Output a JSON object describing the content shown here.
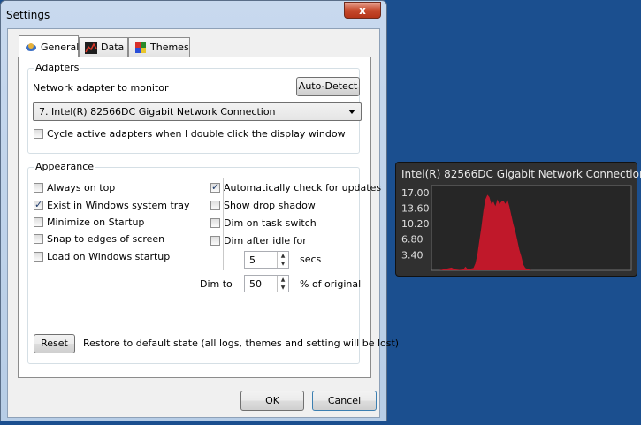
{
  "window": {
    "title": "Settings",
    "close_glyph": "x"
  },
  "tabs": [
    {
      "label": "General",
      "icon": "gear-icon",
      "active": true
    },
    {
      "label": "Data",
      "icon": "chart-icon",
      "active": false
    },
    {
      "label": "Themes",
      "icon": "palette-icon",
      "active": false
    }
  ],
  "adapters": {
    "group_label": "Adapters",
    "monitor_label": "Network adapter to monitor",
    "auto_detect": "Auto-Detect",
    "selected_adapter": "7. Intel(R) 82566DC Gigabit Network Connection",
    "cycle_label": "Cycle active adapters when I double click the display window",
    "cycle_checked": false
  },
  "appearance": {
    "group_label": "Appearance",
    "left_options": [
      {
        "label": "Always on top",
        "checked": false
      },
      {
        "label": "Exist in Windows system tray",
        "checked": true
      },
      {
        "label": "Minimize on Startup",
        "checked": false
      },
      {
        "label": "Snap to edges of screen",
        "checked": false
      },
      {
        "label": "Load on Windows startup",
        "checked": false
      }
    ],
    "right_options": [
      {
        "label": "Automatically check for updates",
        "checked": true
      },
      {
        "label": "Show drop shadow",
        "checked": false
      },
      {
        "label": "Dim on task switch",
        "checked": false
      },
      {
        "label": "Dim after idle for",
        "checked": false
      }
    ],
    "idle_value": "5",
    "idle_unit": "secs",
    "dim_to_label": "Dim to",
    "dim_value": "50",
    "dim_unit": "% of original"
  },
  "reset": {
    "button": "Reset",
    "description": "Restore to default state (all logs, themes and setting will be lost)"
  },
  "footer": {
    "ok": "OK",
    "cancel": "Cancel"
  },
  "gadget": {
    "title": "Intel(R) 82566DC Gigabit Network Connection",
    "background": "#303030",
    "fill_color": "#c0182a"
  },
  "chart_data": {
    "type": "area",
    "ylim": [
      0,
      18.5
    ],
    "ytick_labels": [
      "17.00",
      "13.60",
      "10.20",
      "6.80",
      "3.40"
    ],
    "yticks": [
      17.0,
      13.6,
      10.2,
      6.8,
      3.4
    ],
    "x": [
      0,
      4,
      8,
      10,
      12,
      14,
      16,
      17,
      18,
      19,
      20,
      21,
      22,
      23,
      24,
      25,
      26,
      27,
      28,
      29,
      30,
      31,
      32,
      33,
      34,
      35,
      36,
      37,
      38,
      39,
      40,
      41,
      42,
      43,
      44,
      45,
      46,
      47,
      48,
      50,
      55,
      60,
      70,
      80,
      90,
      100
    ],
    "values": [
      0,
      0,
      0.4,
      0.6,
      0.2,
      0.1,
      0.2,
      0.8,
      0.3,
      0.2,
      0.4,
      0.5,
      1.5,
      3.5,
      6.5,
      9.5,
      13,
      15.5,
      16.5,
      16,
      14.5,
      15,
      14,
      15.5,
      14.5,
      15,
      15.2,
      14.5,
      15.5,
      14,
      12,
      10,
      8.5,
      6.5,
      4.5,
      3,
      1.2,
      0.5,
      0.3,
      0,
      0,
      0,
      0,
      0,
      0,
      0
    ]
  }
}
